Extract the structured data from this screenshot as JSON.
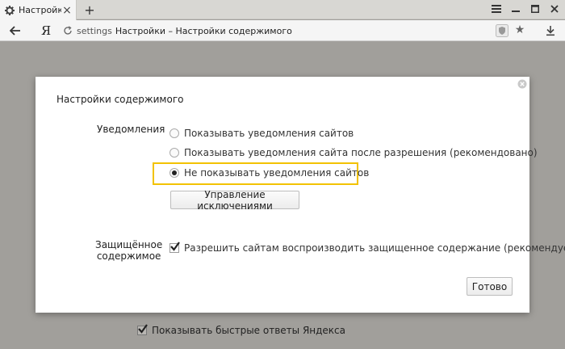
{
  "browser": {
    "tab": {
      "title": "Настройки –",
      "icon": "gear-icon"
    },
    "address_bar": {
      "scheme": "settings",
      "page_title": "Настройки – Настройки содержимого"
    },
    "logo": "Я"
  },
  "dialog": {
    "title": "Настройки содержимого",
    "notifications": {
      "label": "Уведомления",
      "options": [
        {
          "label": "Показывать уведомления сайтов",
          "checked": false
        },
        {
          "label": "Показывать уведомления сайта после разрешения (рекомендовано)",
          "checked": false
        },
        {
          "label": "Не показывать уведомления сайтов",
          "checked": true
        }
      ],
      "manage_button": "Управление исключениями"
    },
    "protected_content": {
      "label_line1": "Защищённое",
      "label_line2": "содержимое",
      "checkbox_label": "Разрешить сайтам воспроизводить защищенное содержание (рекомендуется)",
      "checked": true
    },
    "done_button": "Готово",
    "highlight_color": "#f2c200"
  },
  "background_page": {
    "checkbox_label": "Показывать быстрые ответы Яндекса",
    "checked": true
  }
}
